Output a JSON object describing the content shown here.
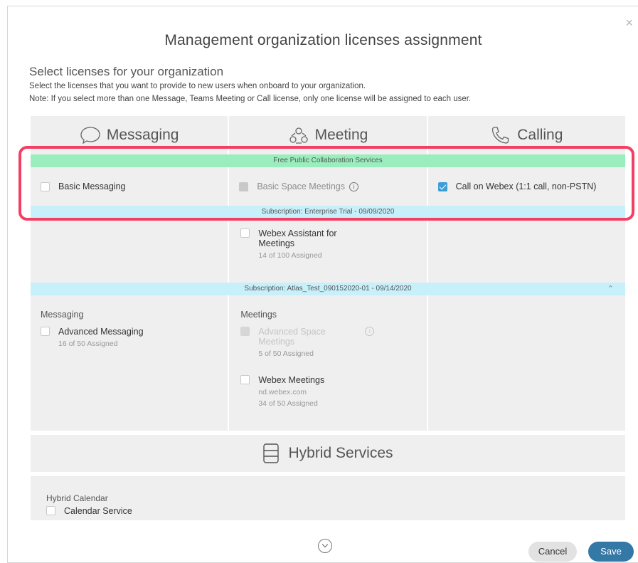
{
  "dialog": {
    "title": "Management organization licenses assignment",
    "subheading": "Select licenses for your organization",
    "description": "Select the licenses that you want to provide to new users when onboard to your organization.",
    "note": "Note: If you select more than one Message, Teams Meeting or Call license, only one license will be assigned to each user.",
    "close_glyph": "×"
  },
  "columns": {
    "messaging": "Messaging",
    "meeting": "Meeting",
    "calling": "Calling"
  },
  "free_services": {
    "band_label": "Free Public Collaboration Services",
    "basic_messaging": "Basic Messaging",
    "basic_space_meetings": "Basic Space Meetings",
    "call_on_webex": "Call on Webex (1:1 call, non-PSTN)",
    "call_on_webex_checked": true
  },
  "subscription_1": {
    "band_label": "Subscription: Enterprise Trial - 09/09/2020",
    "webex_assistant": "Webex Assistant for Meetings",
    "webex_assistant_assigned": "14 of 100 Assigned"
  },
  "subscription_2": {
    "band_label": "Subscription: Atlas_Test_090152020-01 - 09/14/2020",
    "messaging_section": "Messaging",
    "advanced_messaging": "Advanced Messaging",
    "advanced_messaging_assigned": "16 of 50 Assigned",
    "meetings_section": "Meetings",
    "advanced_space_meetings": "Advanced Space Meetings",
    "advanced_space_meetings_assigned": "5 of 50 Assigned",
    "webex_meetings": "Webex Meetings",
    "webex_meetings_site": "nd.webex.com",
    "webex_meetings_assigned": "34 of 50 Assigned"
  },
  "hybrid": {
    "title": "Hybrid Services",
    "calendar_section": "Hybrid Calendar",
    "calendar_service": "Calendar Service"
  },
  "footer": {
    "cancel_label": "Cancel",
    "save_label": "Save"
  },
  "colors": {
    "free_band": "#9aeebd",
    "subscription_band": "#c7f0fb",
    "save_button": "#3478a6",
    "highlight": "#f43f64",
    "checkbox_checked": "#3d9ed8"
  }
}
